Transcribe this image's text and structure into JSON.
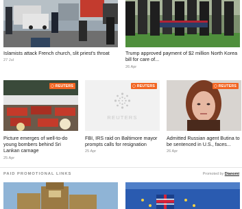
{
  "top_stories": [
    {
      "headline": "Islamists attack French church, slit priest's throat",
      "date": "27 Jul"
    },
    {
      "headline": "Trump approved payment of $2 million North Korea bill for care of...",
      "date": "26 Apr"
    }
  ],
  "mid_stories": [
    {
      "headline": "Picture emerges of well-to-do young bombers behind Sri Lankan carnage",
      "date": "25 Apr",
      "badge": "REUTERS"
    },
    {
      "headline": "FBI, IRS raid on Baltimore mayor prompts calls for resignation",
      "date": "25 Apr",
      "badge": "REUTERS",
      "placeholder_text": "REUTERS"
    },
    {
      "headline": "Admitted Russian agent Butina to be sentenced in U.S., faces...",
      "date": "26 Apr",
      "badge": "REUTERS"
    }
  ],
  "promo": {
    "label": "PAID PROMOTIONAL LINKS",
    "promoted_by": "Promoted by",
    "provider": "Dianomi"
  },
  "colors": {
    "badge": "#f26522"
  }
}
